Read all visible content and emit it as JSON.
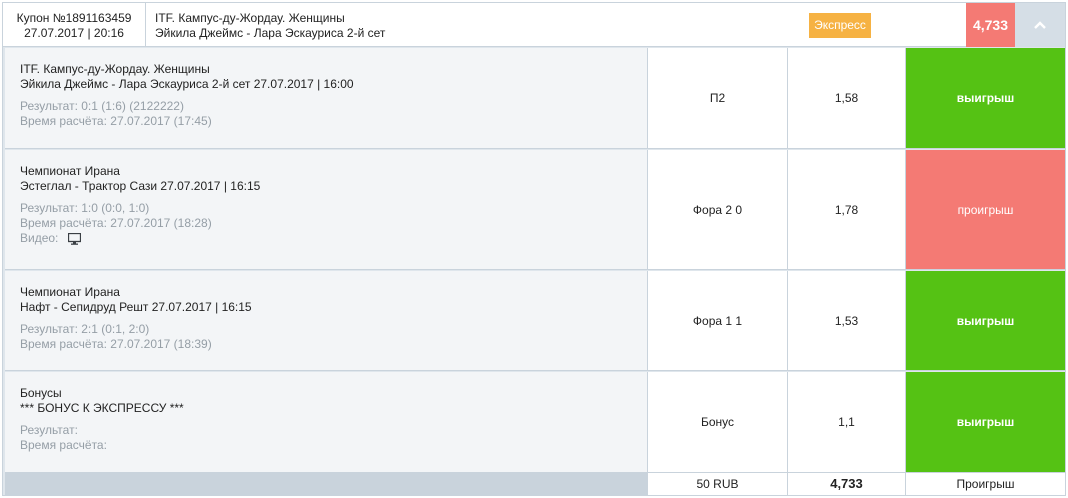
{
  "header": {
    "coupon_label": "Купон №1891163459",
    "coupon_date": "27.07.2017 | 20:16",
    "event_title": "ITF. Кампус-ду-Жордау. Женщины",
    "event_subtitle": "Эйкила Джеймс - Лара Эскауриса 2-й сет",
    "badge": "Экспресс",
    "total_odds": "4,733",
    "toggle_icon": "chevron-up-icon"
  },
  "bets": [
    {
      "league": "ITF. Кампус-ду-Жордау. Женщины",
      "match": "Эйкила Джеймс - Лара Эскауриса 2-й сет 27.07.2017 | 16:00",
      "result": "Результат: 0:1 (1:6) (2122222)",
      "settled": "Время расчёта: 27.07.2017 (17:45)",
      "bet_type": "П2",
      "odds": "1,58",
      "outcome": "выигрыш"
    },
    {
      "league": "Чемпионат Ирана",
      "match": "Эстеглал - Трактор Сази 27.07.2017 | 16:15",
      "result": "Результат: 1:0 (0:0, 1:0)",
      "settled": "Время расчёта: 27.07.2017 (18:28)",
      "video": "Видео:",
      "bet_type": "Фора 2 0",
      "odds": "1,78",
      "outcome": "проигрыш"
    },
    {
      "league": "Чемпионат Ирана",
      "match": "Нафт - Сепидруд Решт 27.07.2017 | 16:15",
      "result": "Результат: 2:1 (0:1, 2:0)",
      "settled": "Время расчёта: 27.07.2017 (18:39)",
      "bet_type": "Фора 1 1",
      "odds": "1,53",
      "outcome": "выигрыш"
    },
    {
      "league": "Бонусы",
      "match": "*** БОНУС К ЭКСПРЕССУ ***",
      "result": "Результат:",
      "settled": "Время расчёта:",
      "bet_type": "Бонус",
      "odds": "1,1",
      "outcome": "выигрыш"
    }
  ],
  "footer": {
    "stake": "50 RUB",
    "total_odds": "4,733",
    "status": "Проигрыш"
  },
  "colors": {
    "win": "#55c214",
    "lose": "#f47a74",
    "badge": "#f6b243"
  }
}
